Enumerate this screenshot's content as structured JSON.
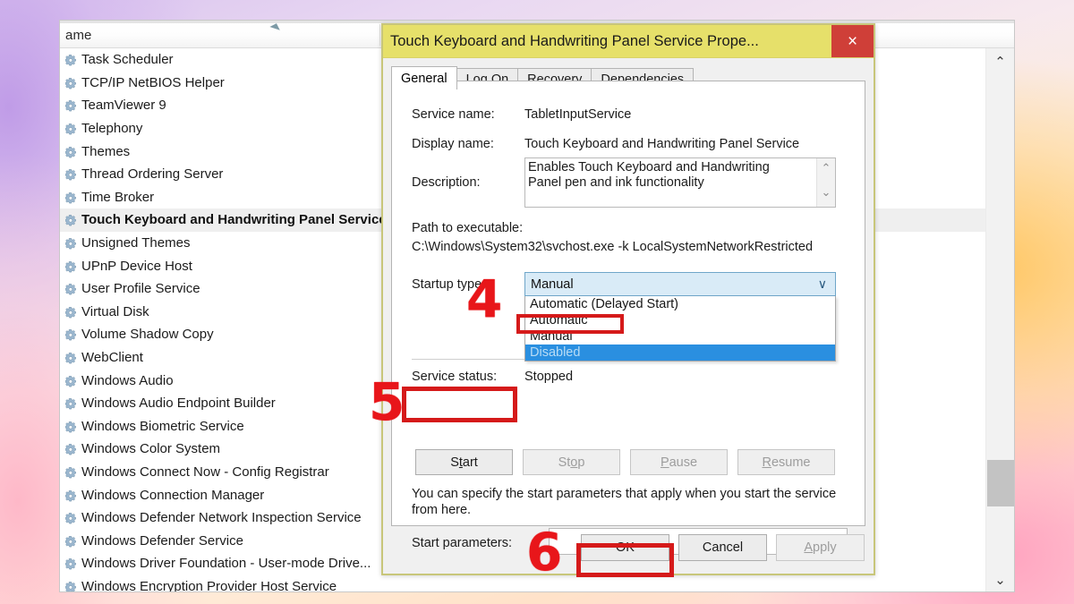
{
  "services_window": {
    "column_header": "ame",
    "sort_indicator": "ascending",
    "services": [
      {
        "name": "Task Scheduler",
        "selected": false
      },
      {
        "name": "TCP/IP NetBIOS Helper",
        "selected": false
      },
      {
        "name": "TeamViewer 9",
        "selected": false
      },
      {
        "name": "Telephony",
        "selected": false
      },
      {
        "name": "Themes",
        "selected": false
      },
      {
        "name": "Thread Ordering Server",
        "selected": false
      },
      {
        "name": "Time Broker",
        "selected": false
      },
      {
        "name": "Touch Keyboard and Handwriting Panel Service",
        "selected": true
      },
      {
        "name": "Unsigned Themes",
        "selected": false
      },
      {
        "name": "UPnP Device Host",
        "selected": false
      },
      {
        "name": "User Profile Service",
        "selected": false
      },
      {
        "name": "Virtual Disk",
        "selected": false
      },
      {
        "name": "Volume Shadow Copy",
        "selected": false
      },
      {
        "name": "WebClient",
        "selected": false
      },
      {
        "name": "Windows Audio",
        "selected": false
      },
      {
        "name": "Windows Audio Endpoint Builder",
        "selected": false
      },
      {
        "name": "Windows Biometric Service",
        "selected": false
      },
      {
        "name": "Windows Color System",
        "selected": false
      },
      {
        "name": "Windows Connect Now - Config Registrar",
        "selected": false
      },
      {
        "name": "Windows Connection Manager",
        "selected": false
      },
      {
        "name": "Windows Defender Network Inspection Service",
        "selected": false
      },
      {
        "name": "Windows Defender Service",
        "selected": false
      },
      {
        "name": "Windows Driver Foundation - User-mode Drive...",
        "selected": false
      },
      {
        "name": "Windows Encryption Provider Host Service",
        "selected": false
      }
    ],
    "scrollbar": {
      "up_glyph": "⌃",
      "down_glyph": "⌄"
    }
  },
  "dialog": {
    "title": "Touch Keyboard and Handwriting Panel Service Prope...",
    "close_glyph": "×",
    "tabs": [
      {
        "label": "General",
        "active": true
      },
      {
        "label": "Log On",
        "active": false
      },
      {
        "label": "Recovery",
        "active": false
      },
      {
        "label": "Dependencies",
        "active": false
      }
    ],
    "fields": {
      "service_name_label": "Service name:",
      "service_name_value": "TabletInputService",
      "display_name_label": "Display name:",
      "display_name_value": "Touch Keyboard and Handwriting Panel Service",
      "description_label": "Description:",
      "description_value": "Enables Touch Keyboard and Handwriting Panel pen and ink functionality",
      "path_label": "Path to executable:",
      "path_value": "C:\\Windows\\System32\\svchost.exe -k LocalSystemNetworkRestricted",
      "startup_type_label": "Startup type:",
      "startup_type_value": "Manual",
      "startup_type_options": [
        {
          "label": "Automatic (Delayed Start)",
          "state": "normal"
        },
        {
          "label": "Automatic",
          "state": "boxed"
        },
        {
          "label": "Manual",
          "state": "normal"
        },
        {
          "label": "Disabled",
          "state": "highlighted"
        }
      ],
      "combo_chevron": "∨",
      "service_status_label": "Service status:",
      "service_status_value": "Stopped",
      "hint_text": "You can specify the start parameters that apply when you start the service from here.",
      "start_parameters_label": "Start parameters:",
      "start_parameters_value": "",
      "desc_scroll_up": "⌃",
      "desc_scroll_down": "⌄"
    },
    "control_buttons": [
      {
        "label": "Start",
        "mnemonic_index": 1,
        "enabled": true
      },
      {
        "label": "Stop",
        "mnemonic_index": 2,
        "enabled": false
      },
      {
        "label": "Pause",
        "mnemonic_index": 0,
        "enabled": false
      },
      {
        "label": "Resume",
        "mnemonic_index": 0,
        "enabled": false
      }
    ],
    "footer_buttons": [
      {
        "label": "OK",
        "enabled": true
      },
      {
        "label": "Cancel",
        "enabled": true
      },
      {
        "label": "Apply",
        "enabled": false
      }
    ]
  },
  "annotations": {
    "markers": [
      {
        "number": "4",
        "target": "startup-type-dropdown"
      },
      {
        "number": "5",
        "target": "start-button"
      },
      {
        "number": "6",
        "target": "ok-button"
      }
    ],
    "accent_color": "#d51a1a",
    "numeral_color": "#e8161a"
  },
  "colors": {
    "title_bar": "#e6e06a",
    "close_button": "#cf3f38",
    "combo_selected": "#d9ebf7",
    "option_highlight": "#2a8fe0",
    "dialog_border": "#c8c67a"
  }
}
